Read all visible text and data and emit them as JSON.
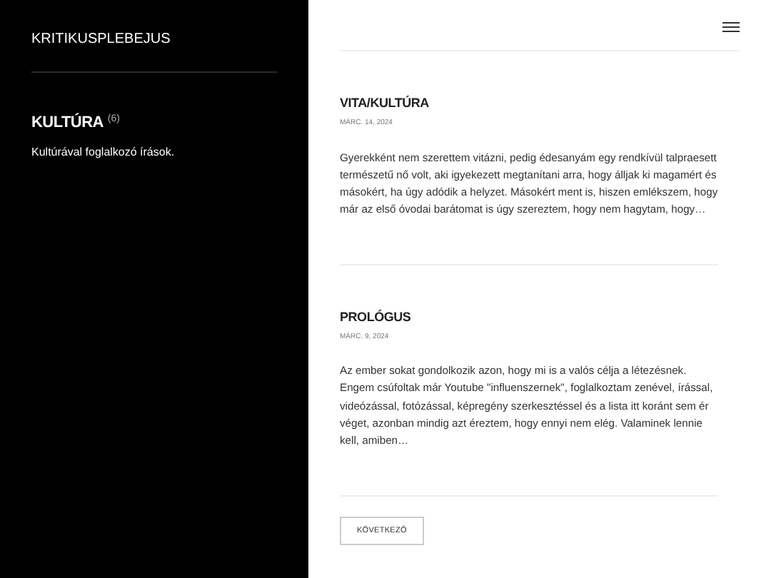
{
  "site_title": "KRITIKUSPLEBEJUS",
  "category": {
    "title": "KULTÚRA",
    "count": "(6)",
    "description": "Kultúrával foglalkozó írások."
  },
  "posts": [
    {
      "title": "VITA/KULTÚRA",
      "date": "MÁRC. 14, 2024",
      "excerpt": "Gyerekként nem szerettem vitázni, pedig édesanyám egy rendkívül talpraesett természetű nő volt, aki igyekezett megtanítani arra, hogy álljak ki magamért és másokért, ha úgy adódik a helyzet. Másokért ment is, hiszen emlékszem, hogy már az első óvodai barátomat is úgy szereztem, hogy nem hagytam, hogy…"
    },
    {
      "title": "PROLÓGUS",
      "date": "MÁRC. 9, 2024",
      "excerpt": "Az ember sokat gondolkozik azon, hogy mi is a valós célja a létezésnek. Engem csúfoltak már Youtube \"influenszernek\", foglalkoztam zenével, írással, videózással, fotózással, képregény szerkesztéssel és a lista itt koránt sem ér véget, azonban mindig azt éreztem, hogy ennyi nem elég. Valaminek lennie kell, amiben…"
    }
  ],
  "next_button": "KÖVETKEZŐ"
}
